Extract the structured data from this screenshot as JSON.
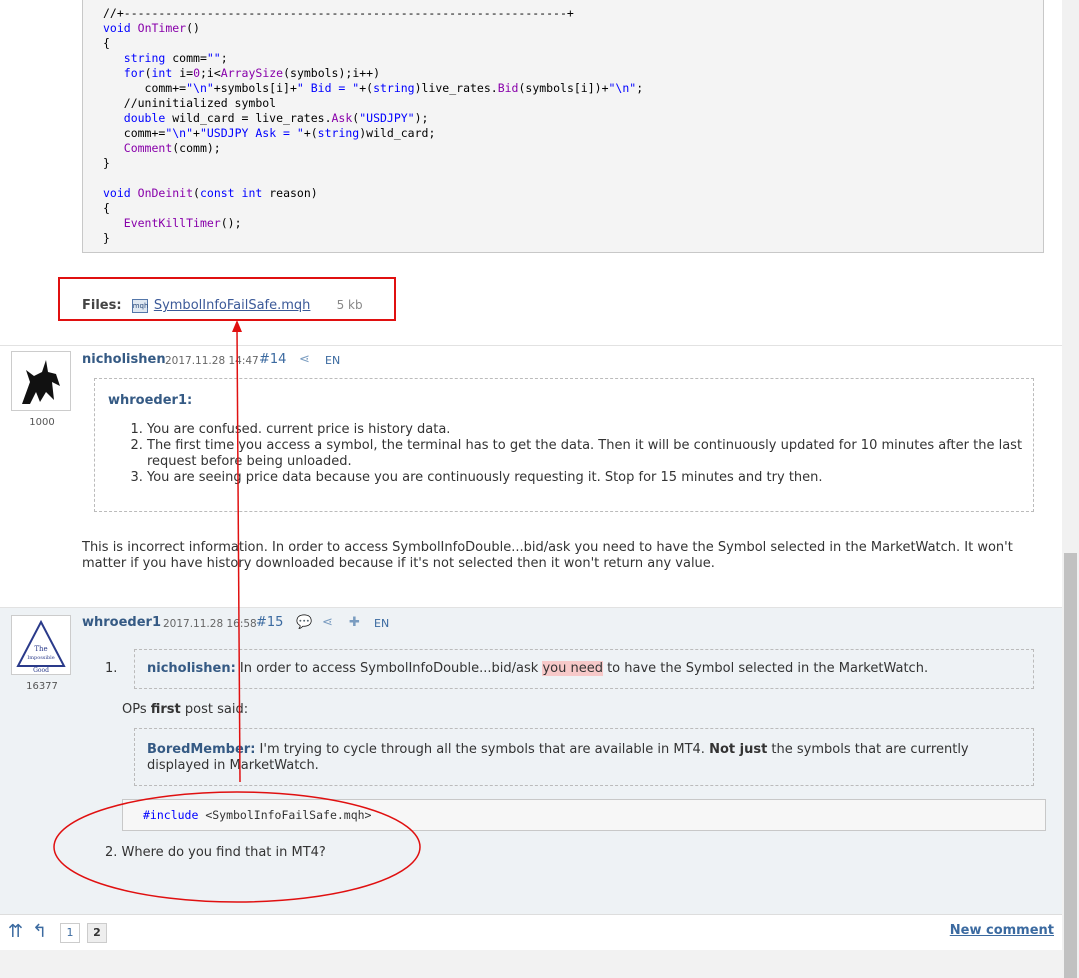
{
  "code_block": {
    "lines": [
      "//+----------------------------------------------------------------+",
      "void OnTimer()",
      "{",
      "   string comm=\"\";",
      "   for(int i=0;i<ArraySize(symbols);i++)",
      "      comm+=\"\\n\"+symbols[i]+\" Bid = \"+(string)live_rates.Bid(symbols[i])+\"\\n\";",
      "   //uninitialized symbol",
      "   double wild_card = live_rates.Ask(\"USDJPY\");",
      "   comm+=\"\\n\"+\"USDJPY Ask = \"+(string)wild_card;",
      "   Comment(comm);",
      "}",
      "",
      "void OnDeinit(const int reason)",
      "{",
      "   EventKillTimer();",
      "}"
    ]
  },
  "files": {
    "label": "Files:",
    "filename": "SymbolInfoFailSafe.mqh",
    "size": "5 kb"
  },
  "post14": {
    "author": "nicholishen",
    "rating": "1000",
    "date": "2017.11.28 14:47",
    "number": "#14",
    "lang": "EN",
    "quote_author": "whroeder1:",
    "quote_items": [
      "You are confused. current price is history data.",
      "The first time you access a symbol, the terminal has to get the data. Then it will be continuously updated for 10 minutes after the last request before being unloaded.",
      "You are seeing price data because you are continuously requesting it. Stop for 15 minutes and try then."
    ],
    "body": "This is incorrect information. In order to access SymbolInfoDouble...bid/ask you need to have the Symbol selected in the MarketWatch. It won't matter if you have history downloaded because if it's not selected then it won't return any value."
  },
  "post15": {
    "author": "whroeder1",
    "rating": "16377",
    "date": "2017.11.28 16:58",
    "number": "#15",
    "lang": "EN",
    "item1_num": "1.",
    "quote1_author": "nicholishen:",
    "quote1_before": " In order to access SymbolInfoDouble...bid/ask ",
    "quote1_highlight": "you need",
    "quote1_after": " to have the Symbol selected in the MarketWatch.",
    "ops_before": "OPs ",
    "ops_bold": "first",
    "ops_after": " post said:",
    "quote2_author": "BoredMember:",
    "quote2_before": " I'm trying to cycle through all the symbols that are available in MT4. ",
    "quote2_bold": "Not just",
    "quote2_after": " the symbols that are currently displayed in MarketWatch.",
    "code_include": "#include",
    "code_file": " <SymbolInfoFailSafe.mqh>",
    "item2": "2. Where do you find that in MT4?"
  },
  "pager": {
    "page1": "1",
    "page2": "2",
    "new_comment": "New comment"
  },
  "accent_color": "#e01010"
}
